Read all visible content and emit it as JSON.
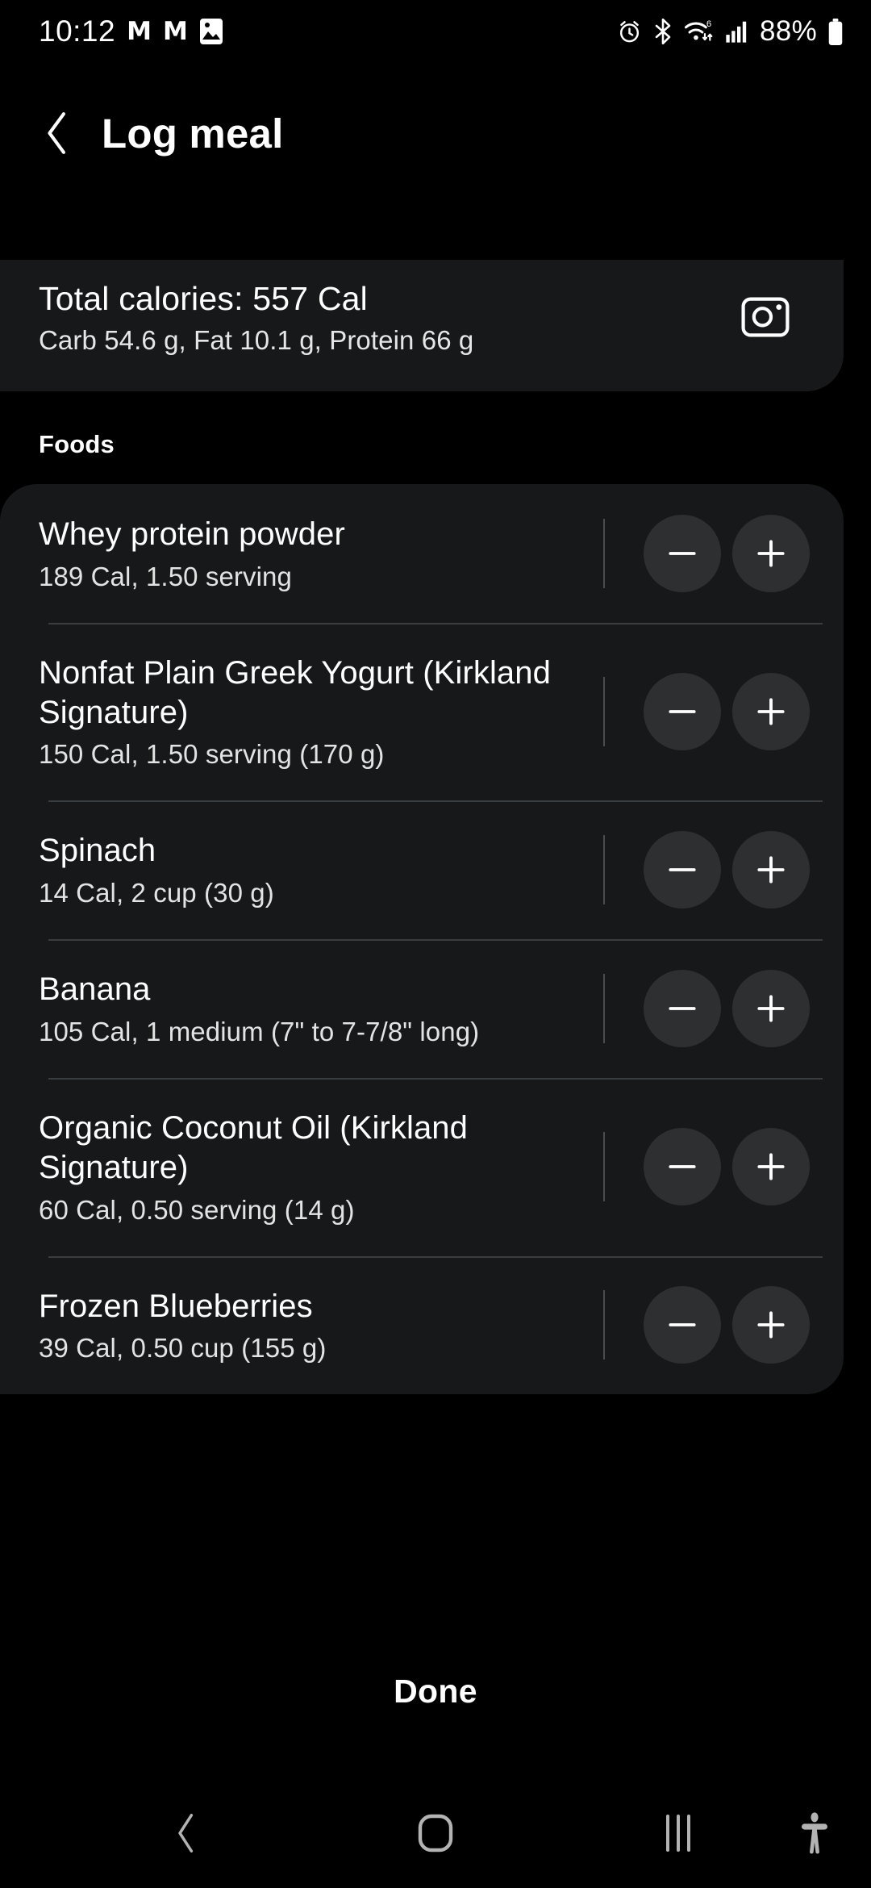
{
  "status_bar": {
    "time": "10:12",
    "left_icons": [
      {
        "name": "gmail-icon",
        "glyph": "M"
      },
      {
        "name": "gmail-icon",
        "glyph": "M"
      },
      {
        "name": "image-icon",
        "glyph": "image"
      }
    ],
    "right_icons": [
      {
        "name": "alarm-icon"
      },
      {
        "name": "bluetooth-icon"
      },
      {
        "name": "wifi-6-icon",
        "badge": "6"
      },
      {
        "name": "cellular-signal-icon"
      }
    ],
    "battery_percent": "88%",
    "battery_icon": "battery-icon"
  },
  "app_bar": {
    "back_icon": "back-chevron-icon",
    "title": "Log meal"
  },
  "summary": {
    "total_calories": "Total calories: 557 Cal",
    "macros": "Carb 54.6 g, Fat 10.1 g, Protein 66 g",
    "camera_icon": "camera-icon"
  },
  "foods_section": {
    "label": "Foods",
    "items": [
      {
        "name": "Whey protein powder",
        "detail": "189 Cal, 1.50 serving",
        "decrease_label": "minus-icon",
        "increase_label": "plus-icon"
      },
      {
        "name": "Nonfat Plain Greek Yogurt (Kirkland Signature)",
        "detail": "150 Cal, 1.50 serving (170 g)",
        "decrease_label": "minus-icon",
        "increase_label": "plus-icon"
      },
      {
        "name": "Spinach",
        "detail": "14 Cal, 2 cup (30 g)",
        "decrease_label": "minus-icon",
        "increase_label": "plus-icon"
      },
      {
        "name": "Banana",
        "detail": "105 Cal, 1 medium (7\" to 7-7/8\" long)",
        "decrease_label": "minus-icon",
        "increase_label": "plus-icon"
      },
      {
        "name": "Organic Coconut Oil (Kirkland Signature)",
        "detail": "60 Cal, 0.50 serving (14 g)",
        "decrease_label": "minus-icon",
        "increase_label": "plus-icon"
      },
      {
        "name": "Frozen Blueberries",
        "detail": "39 Cal, 0.50 cup (155 g)",
        "decrease_label": "minus-icon",
        "increase_label": "plus-icon"
      }
    ]
  },
  "footer": {
    "done_label": "Done"
  },
  "nav_bar": {
    "back_icon": "nav-back-icon",
    "home_icon": "nav-home-icon",
    "recents_icon": "nav-recents-icon",
    "accessibility_icon": "accessibility-icon"
  },
  "colors": {
    "page_background": "#000000",
    "card_background": "#17181a",
    "button_background": "#2e2f31",
    "divider": "#3a3d40",
    "text_primary": "#ffffff",
    "text_secondary": "#e3e3e3",
    "nav_icon": "#b3b3b3"
  }
}
